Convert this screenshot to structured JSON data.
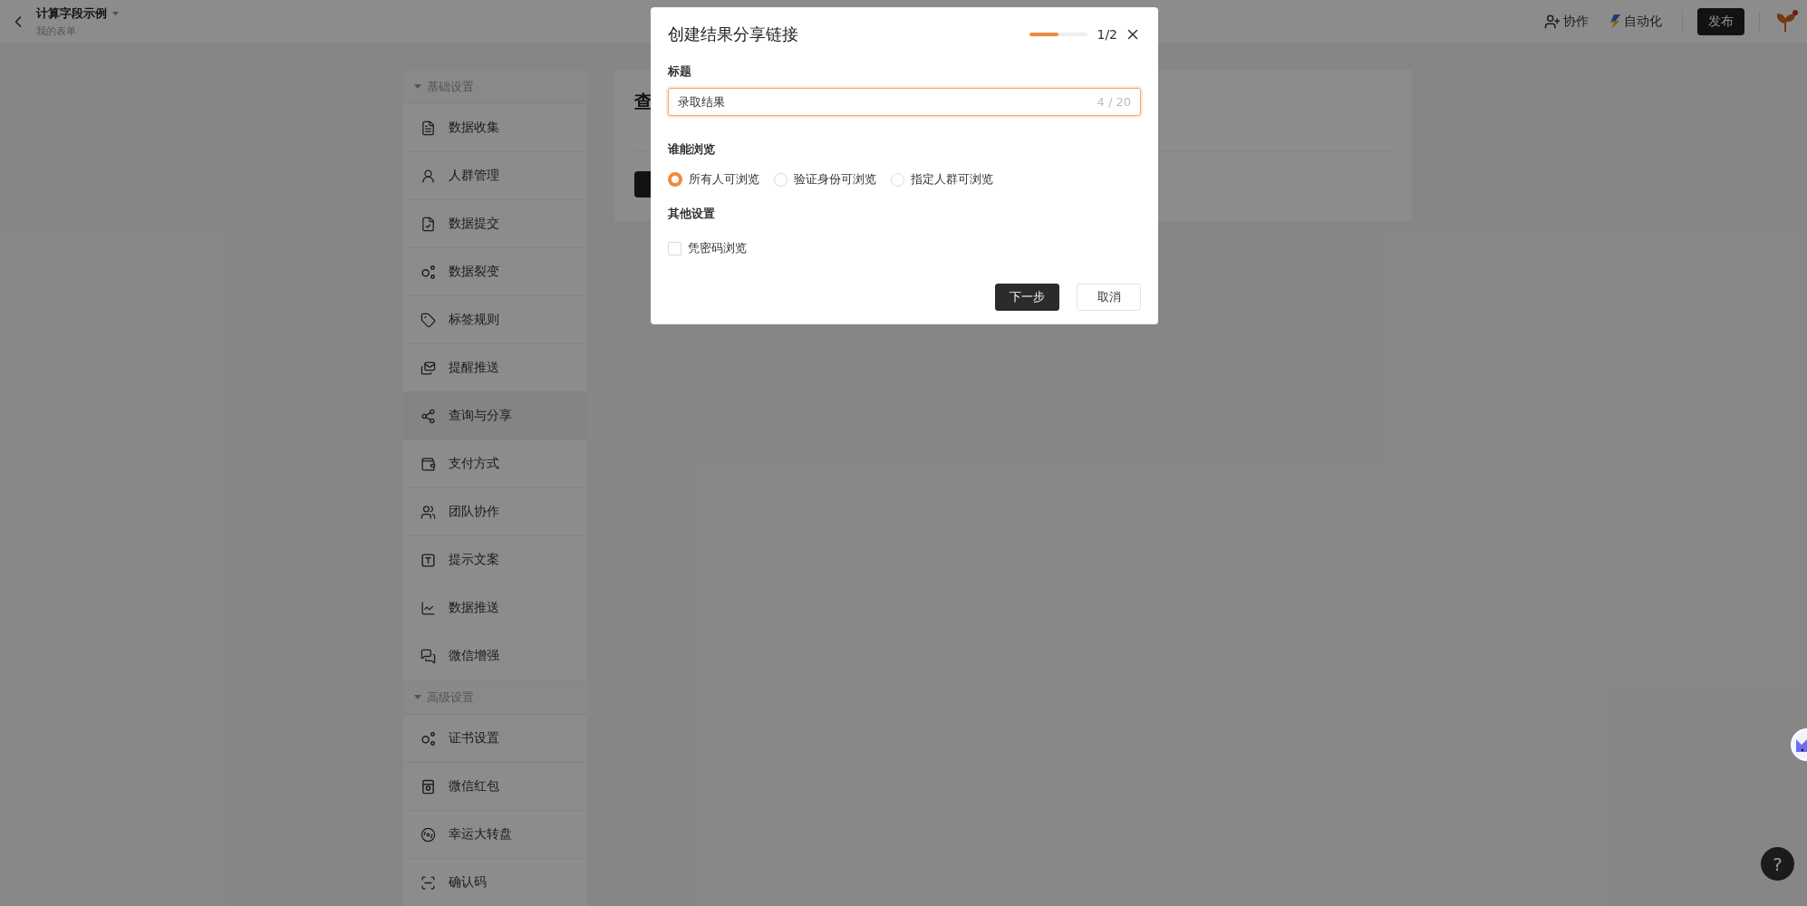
{
  "topbar": {
    "title": "计算字段示例",
    "subtitle": "我的表单",
    "actions": [
      {
        "label": "协作",
        "kind": "collab"
      },
      {
        "label": "自动化",
        "kind": "automation"
      }
    ],
    "publish": "发布"
  },
  "sidebar": {
    "sections": [
      {
        "title": "基础设置",
        "expanded": true,
        "items": [
          {
            "label": "数据收集",
            "kind": "doc",
            "selected": false
          },
          {
            "label": "人群管理",
            "kind": "user",
            "selected": false
          },
          {
            "label": "数据提交",
            "kind": "doccheck",
            "selected": false
          },
          {
            "label": "数据裂变",
            "kind": "nodes",
            "selected": false
          },
          {
            "label": "标签规则",
            "kind": "tag",
            "selected": false
          },
          {
            "label": "提醒推送",
            "kind": "mail",
            "selected": false
          },
          {
            "label": "查询与分享",
            "kind": "share",
            "selected": true
          },
          {
            "label": "支付方式",
            "kind": "wallet",
            "selected": false
          },
          {
            "label": "团队协作",
            "kind": "users",
            "selected": false
          },
          {
            "label": "提示文案",
            "kind": "text",
            "selected": false
          },
          {
            "label": "数据推送",
            "kind": "chart",
            "selected": false
          },
          {
            "label": "微信增强",
            "kind": "chat",
            "selected": false
          }
        ]
      },
      {
        "title": "高级设置",
        "expanded": true,
        "items": [
          {
            "label": "证书设置",
            "kind": "nodes",
            "selected": false
          },
          {
            "label": "微信红包",
            "kind": "card",
            "selected": false
          },
          {
            "label": "幸运大转盘",
            "kind": "disc",
            "selected": false
          },
          {
            "label": "确认码",
            "kind": "scan",
            "selected": false
          }
        ]
      }
    ]
  },
  "content": {
    "title": "查"
  },
  "dialog": {
    "title": "创建结果分享链接",
    "step": {
      "level": 0.5,
      "text": "1/2"
    },
    "title_field": {
      "label": "标题",
      "value": "录取结果",
      "counter": "4 / 20"
    },
    "visibility": {
      "label": "谁能浏览",
      "options": [
        {
          "label": "所有人可浏览",
          "selected": true
        },
        {
          "label": "验证身份可浏览",
          "selected": false
        },
        {
          "label": "指定人群可浏览",
          "selected": false
        }
      ]
    },
    "other": {
      "label": "其他设置",
      "options": [
        {
          "label": "凭密码浏览",
          "checked": false
        }
      ]
    },
    "buttons": [
      {
        "label": "下一步",
        "kind": "primary"
      },
      {
        "label": "取消",
        "kind": "secondary"
      }
    ]
  },
  "help": "?"
}
